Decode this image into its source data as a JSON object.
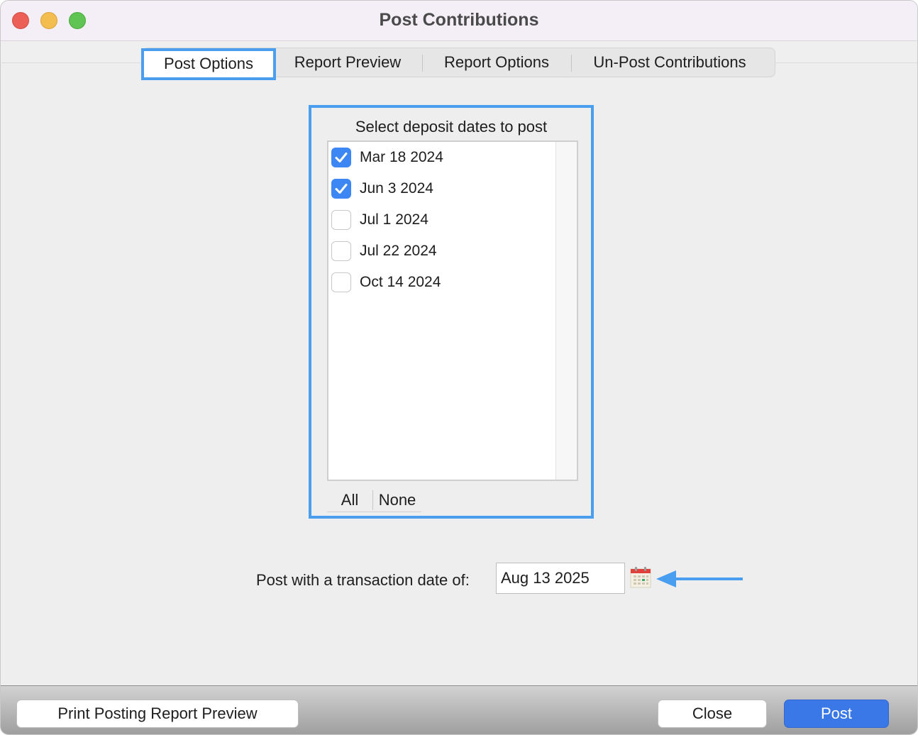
{
  "window": {
    "title": "Post Contributions"
  },
  "tabs": [
    {
      "label": "Post Options",
      "active": true
    },
    {
      "label": "Report Preview",
      "active": false
    },
    {
      "label": "Report Options",
      "active": false
    },
    {
      "label": "Un-Post Contributions",
      "active": false
    }
  ],
  "deposit": {
    "title": "Select deposit dates to post",
    "items": [
      {
        "label": "Mar 18 2024",
        "checked": true
      },
      {
        "label": "Jun 3 2024",
        "checked": true
      },
      {
        "label": "Jul 1 2024",
        "checked": false
      },
      {
        "label": "Jul 22 2024",
        "checked": false
      },
      {
        "label": "Oct 14 2024",
        "checked": false
      }
    ],
    "all_label": "All",
    "none_label": "None"
  },
  "transaction": {
    "label": "Post with a transaction date of:",
    "value": "Aug 13 2025"
  },
  "footer": {
    "print_label": "Print Posting Report Preview",
    "close_label": "Close",
    "post_label": "Post"
  },
  "colors": {
    "highlight": "#4a9ef0",
    "checkbox_checked": "#3d87f5",
    "primary_button": "#3b78e7"
  }
}
